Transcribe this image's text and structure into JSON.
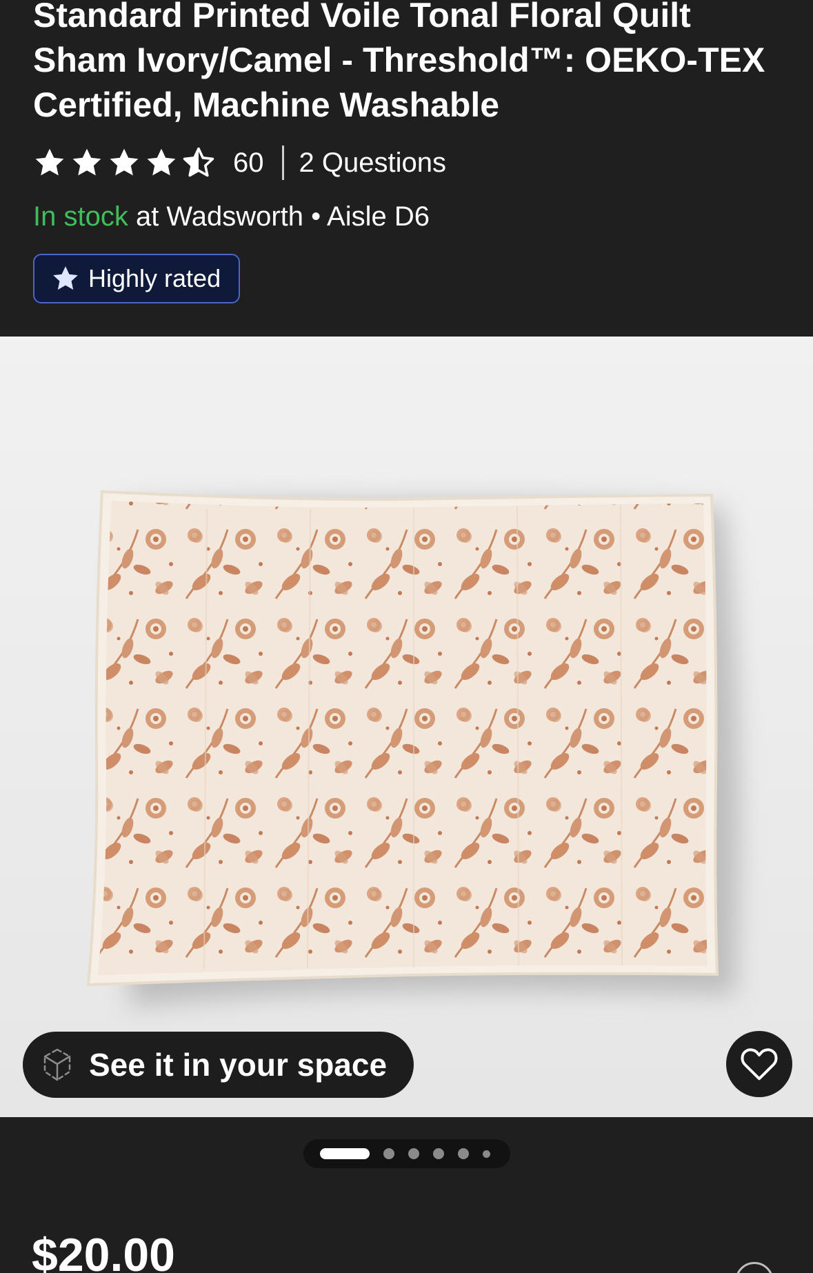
{
  "product": {
    "title": "Standard Printed Voile Tonal Floral Quilt Sham Ivory/Camel - Threshold™: OEKO-TEX Certified, Machine Washable",
    "rating": 4.5,
    "rating_max": 5,
    "review_count": "60",
    "questions_label": "2 Questions",
    "stock_status": "In stock",
    "stock_location": " at Wadsworth • Aisle D6",
    "badge_label": "Highly rated",
    "price": "$20.00"
  },
  "gallery": {
    "ar_button_label": "See it in your space",
    "image_count": 6,
    "active_index": 0
  },
  "icons": {
    "rating": "star-icon",
    "badge": "star-icon",
    "ar": "cube-ar-icon",
    "favorite": "heart-icon",
    "info": "info-icon"
  },
  "colors": {
    "background": "#1f1f1f",
    "in_stock": "#3fbf5a",
    "badge_background": "#0f1a3a",
    "badge_border": "#4a66c8",
    "pattern": "#c87e55"
  }
}
